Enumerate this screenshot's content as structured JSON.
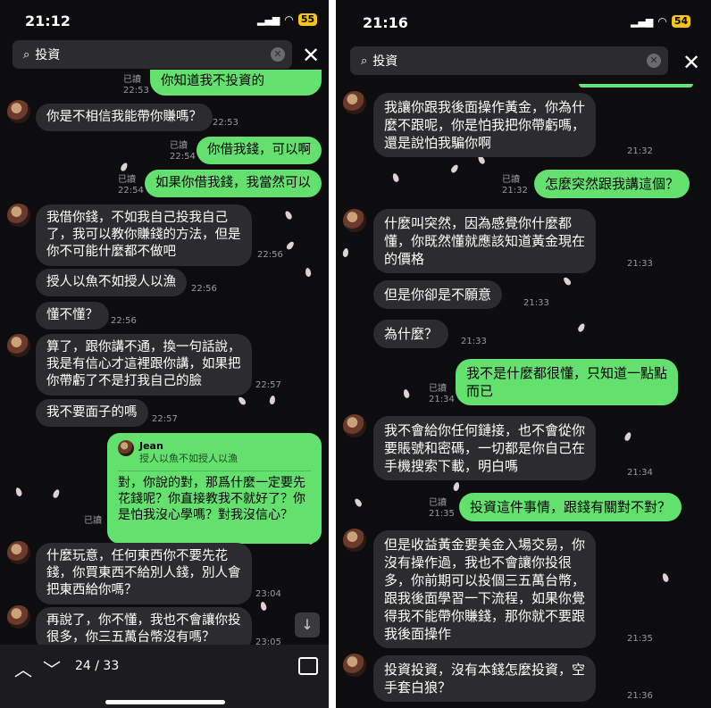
{
  "left": {
    "time": "21:12",
    "battery": "55",
    "search_query": "投資",
    "pager": "24 / 33",
    "read_label": "已讀",
    "cut_top_text": "你知道我不投資的",
    "messages": [
      {
        "text": "你是不相信我能帶你賺嗎？",
        "time": "22:53"
      },
      {
        "text": "你借我錢，可以啊",
        "time": "22:54"
      },
      {
        "text": "如果你借我錢，我當然可以",
        "time": "22:54"
      },
      {
        "text": "我借你錢，不如我自己投我自己\n了，我可以教你賺錢的方法，但是\n你不可能什麼都不做吧",
        "time": "22:56"
      },
      {
        "text": "授人以魚不如授人以漁",
        "time": "22:56"
      },
      {
        "text": "懂不懂？",
        "time": "22:56"
      },
      {
        "text": "算了，跟你講不通，換一句話說，\n我是有信心才這裡跟你講，如果把\n你帶虧了不是打我自己的臉",
        "time": "22:57"
      },
      {
        "text": "我不要面子的嗎",
        "time": "22:57"
      },
      {
        "reply_name": "Jean",
        "reply_quote": "授人以魚不如授人以漁",
        "text": "對，你說的對，那爲什麼一定要先\n花錢呢？你直接教我不就好了？你\n是怕我沒心學嗎？對我沒信心？",
        "time": ""
      },
      {
        "text": "什麼玩意，任何東西你不要先花\n錢，你買東西不給別人錢，別人會\n把東西給你嗎？",
        "time": "23:04"
      },
      {
        "text": "再說了，你不懂，我也不會讓你投\n很多，你三五萬台幣沒有嗎？",
        "time": "23:05"
      }
    ]
  },
  "right": {
    "time": "21:16",
    "battery": "54",
    "search_query": "投資",
    "read_label": "已讀",
    "messages": [
      {
        "text": "我讓你跟我後面操作黃金，你為什\n麼不跟呢，你是怕我把你帶虧嗎，\n還是說怕我騙你啊",
        "time": "21:32"
      },
      {
        "text": "怎麼突然跟我講這個？",
        "time": "21:32"
      },
      {
        "text": "什麼叫突然，因為感覺你什麼都\n懂，你既然懂就應該知道黃金現在\n的價格",
        "time": "21:33"
      },
      {
        "text": "但是你卻是不願意",
        "time": "21:33"
      },
      {
        "text": "為什麼？",
        "time": "21:33"
      },
      {
        "text": "我不是什麼都很懂，只知道一點點\n而已",
        "time": "21:34"
      },
      {
        "text": "我不會給你任何鏈接，也不會從你\n要賬號和密碼，一切都是你自己在\n手機搜索下載，明白嗎",
        "time": "21:34"
      },
      {
        "text": "投資這件事情，跟錢有關對不對？",
        "time": "21:35"
      },
      {
        "text": "但是收益黃金要美金入場交易，你\n沒有操作過，我也不會讓你投很\n多，你前期可以投個三五萬台幣，\n跟我後面學習一下流程，如果你覺\n得我不能帶你賺錢，那你就不要跟\n我後面操作",
        "time": "21:35"
      },
      {
        "text": "投資投資，沒有本錢怎麼投資，空\n手套白狼？",
        "time": "21:36"
      }
    ]
  }
}
